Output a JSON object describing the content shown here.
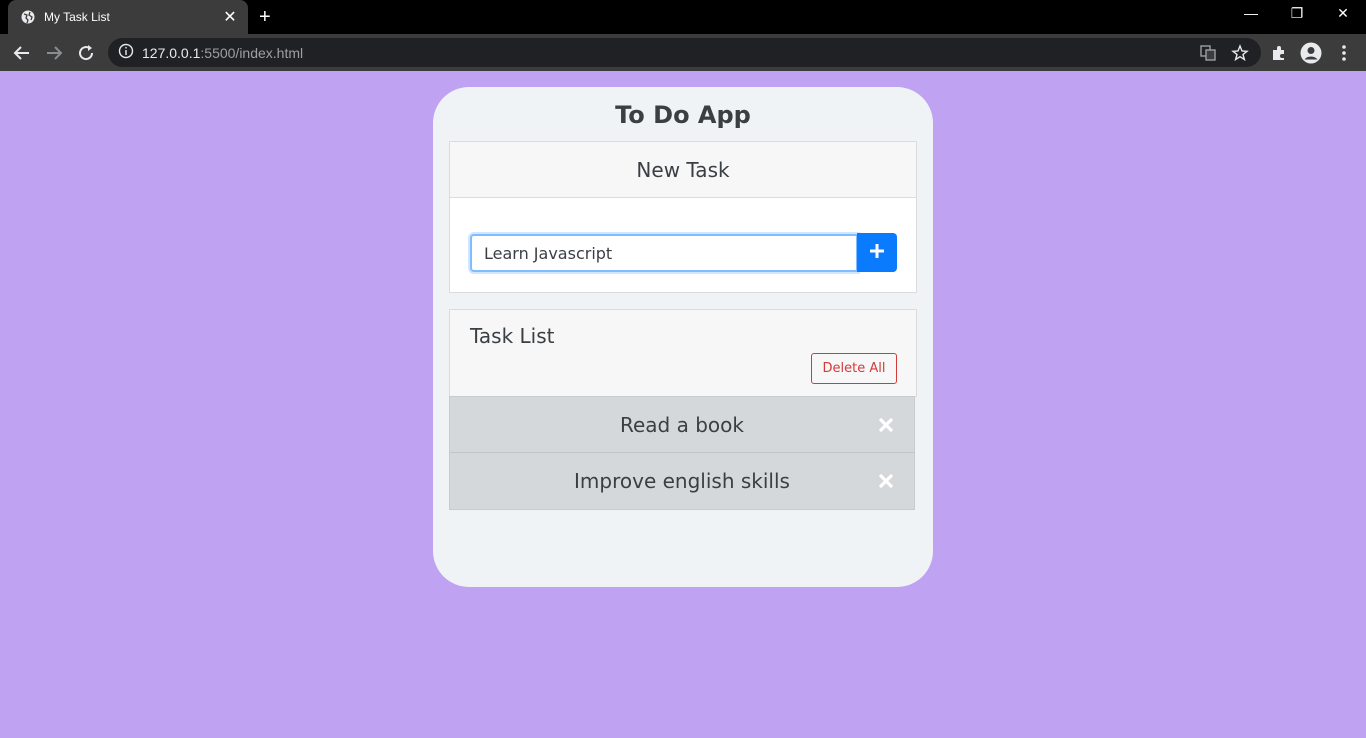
{
  "browser": {
    "tab_title": "My Task List",
    "tab_close": "✕",
    "new_tab": "+",
    "url_host": "127.0.0.1",
    "url_rest": ":5500/index.html",
    "window_minimize": "—",
    "window_restore": "❐",
    "window_close": "✕"
  },
  "app": {
    "title": "To Do App",
    "new_task": {
      "header": "New Task",
      "input_value": "Learn Javascript",
      "add_icon": "plus-icon"
    },
    "task_list": {
      "header": "Task List",
      "delete_all_label": "Delete All",
      "items": [
        {
          "text": "Read a book"
        },
        {
          "text": "Improve english skills"
        }
      ]
    }
  },
  "colors": {
    "page_background": "#bfa2f2",
    "accent": "#0a7bfd",
    "danger": "#d33a3a"
  }
}
